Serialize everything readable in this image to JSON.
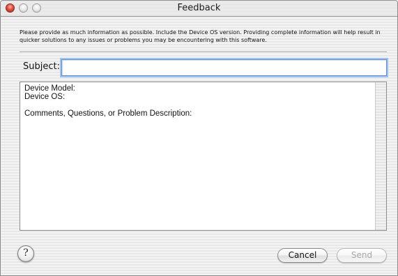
{
  "window": {
    "title": "Feedback",
    "controls": [
      "close-button",
      "minimize-button",
      "zoom-button"
    ]
  },
  "instructions": "Please provide as much information as possible.  Include the Device OS version.   Providing complete information will help result in quicker solutions to any issues or problems you may be encountering with this software.",
  "subject": {
    "label": "Subject:",
    "value": "",
    "placeholder": ""
  },
  "message": {
    "value": "Device Model:\nDevice OS:\n\nComments, Questions, or Problem Description:"
  },
  "buttons": {
    "help_glyph": "?",
    "cancel": "Cancel",
    "send": "Send"
  },
  "colors": {
    "focus_ring": "#9ec3f2",
    "close_button": "#e0503e"
  }
}
